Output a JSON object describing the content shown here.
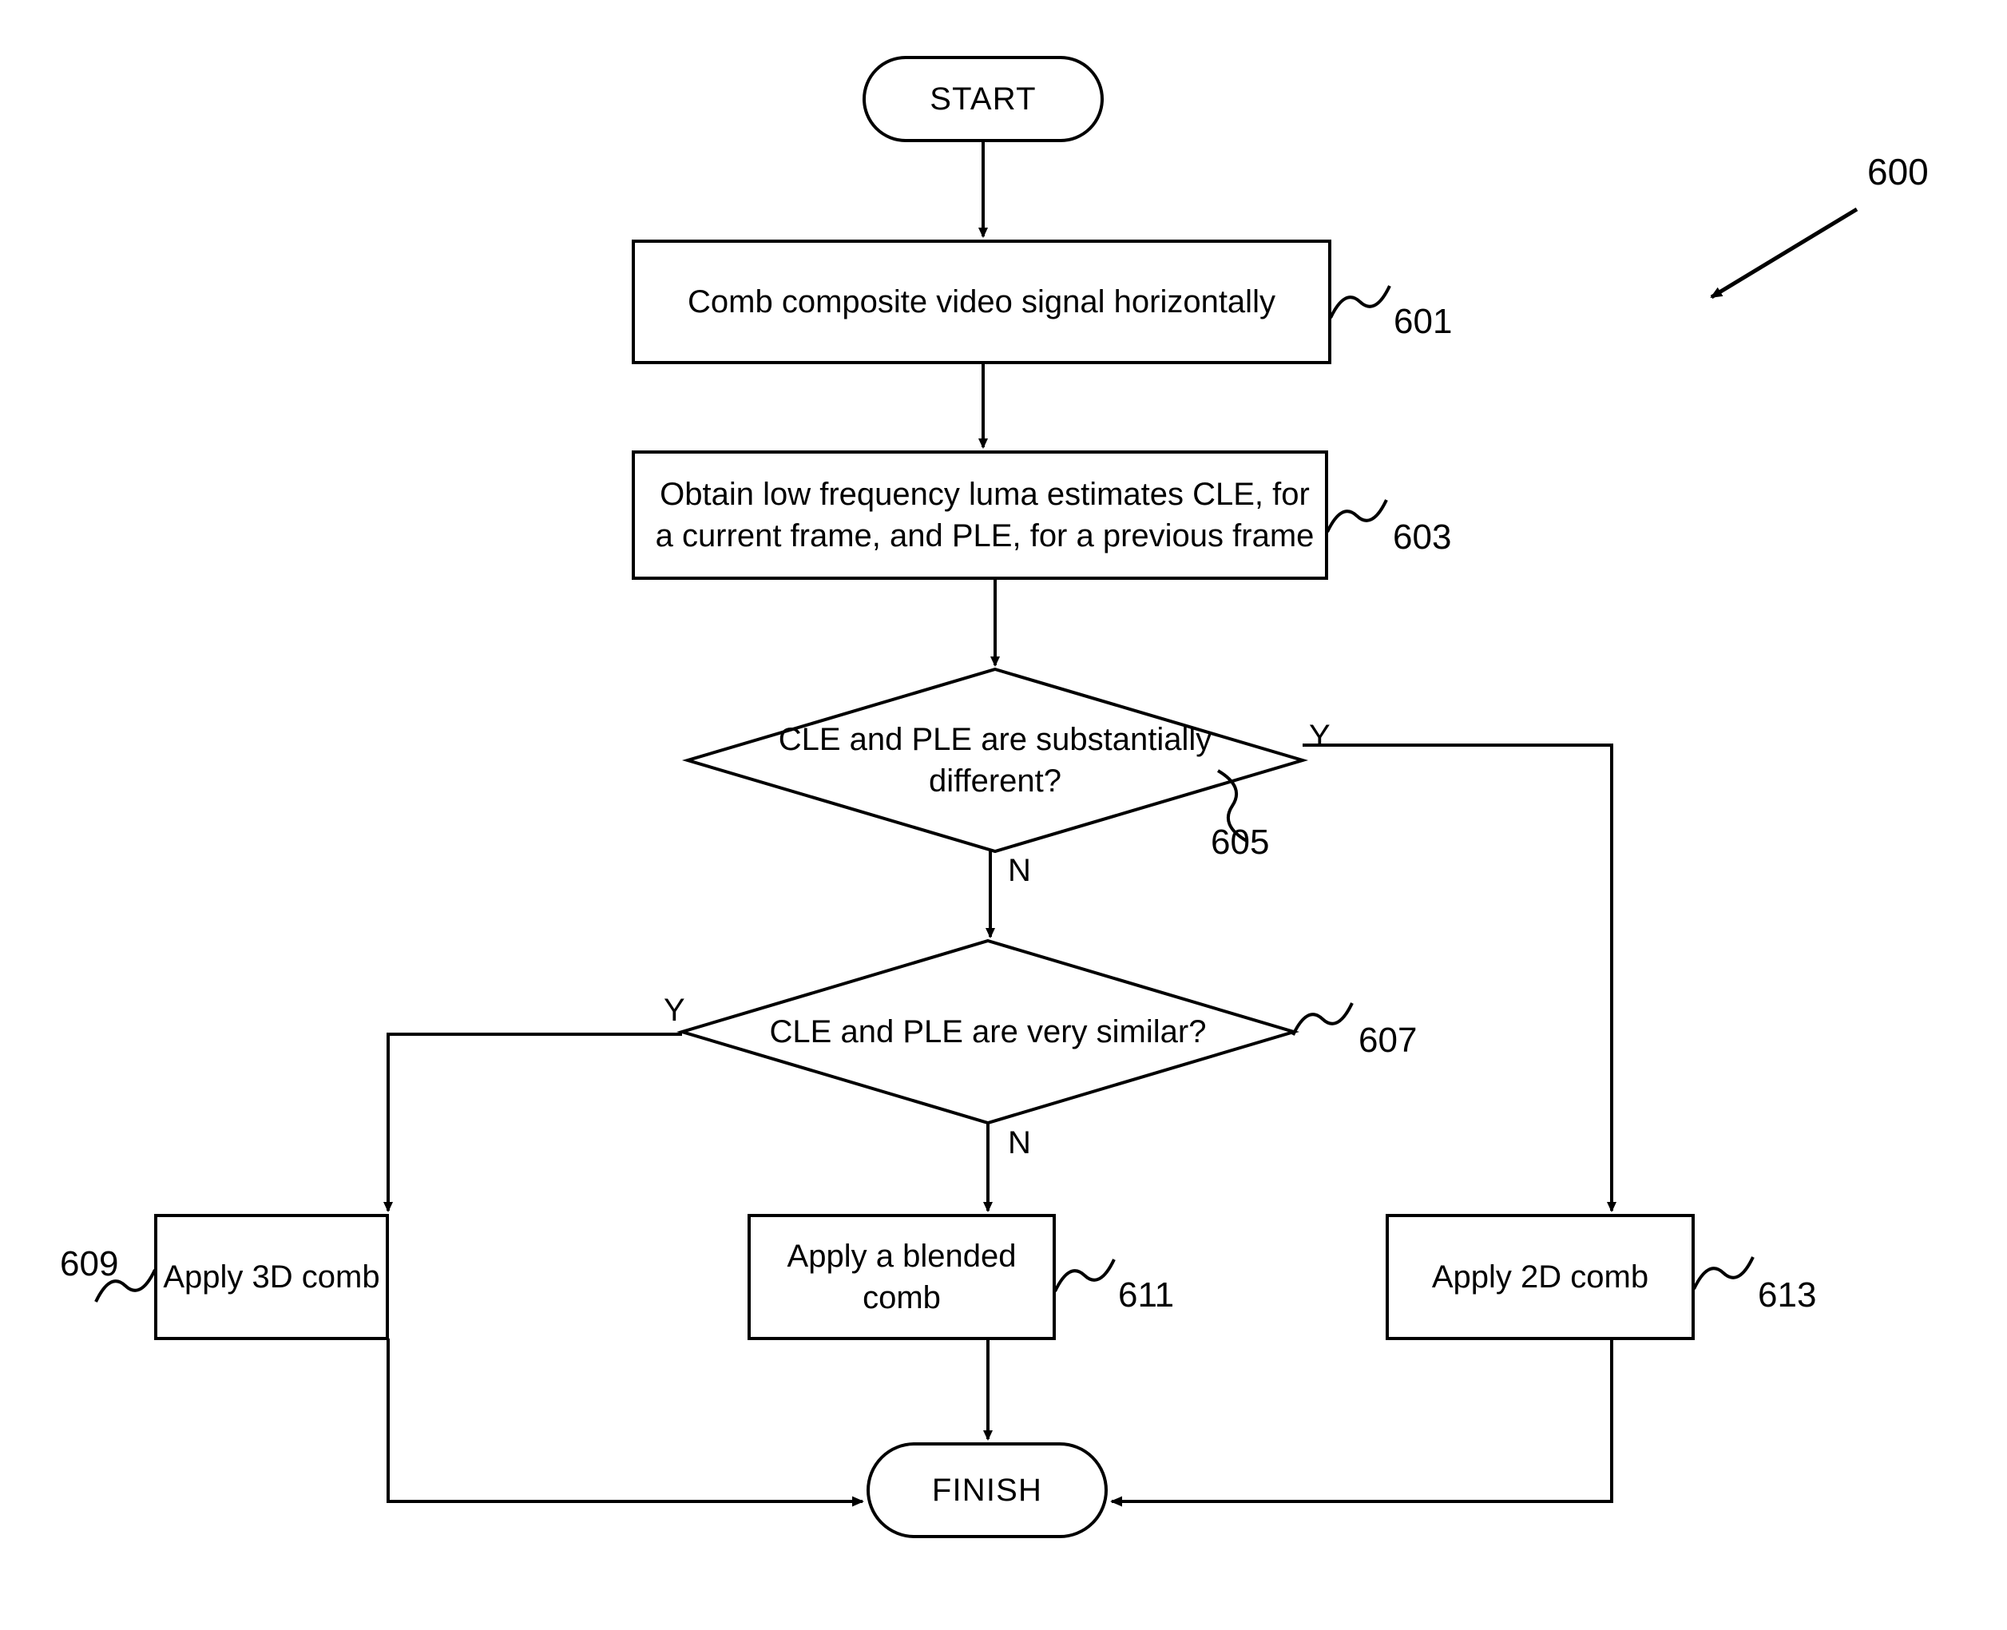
{
  "figure": {
    "reference_numeral": "600"
  },
  "nodes": {
    "start": {
      "label": "START",
      "ref": ""
    },
    "step601": {
      "label": "Comb composite video signal horizontally",
      "ref": "601"
    },
    "step603": {
      "label": "Obtain low frequency luma estimates CLE, for a current frame, and PLE, for a previous frame",
      "ref": "603"
    },
    "decision605": {
      "label": "CLE and PLE are substantially different?",
      "ref": "605"
    },
    "decision607": {
      "label": "CLE and PLE are very similar?",
      "ref": "607"
    },
    "step609": {
      "label": "Apply 3D comb",
      "ref": "609"
    },
    "step611": {
      "label": "Apply a blended comb",
      "ref": "611"
    },
    "step613": {
      "label": "Apply 2D comb",
      "ref": "613"
    },
    "finish": {
      "label": "FINISH",
      "ref": ""
    }
  },
  "branch_labels": {
    "d605_yes": "Y",
    "d605_no": "N",
    "d607_yes": "Y",
    "d607_no": "N"
  },
  "colors": {
    "stroke": "#000000",
    "fill": "#ffffff",
    "text": "#000000"
  }
}
